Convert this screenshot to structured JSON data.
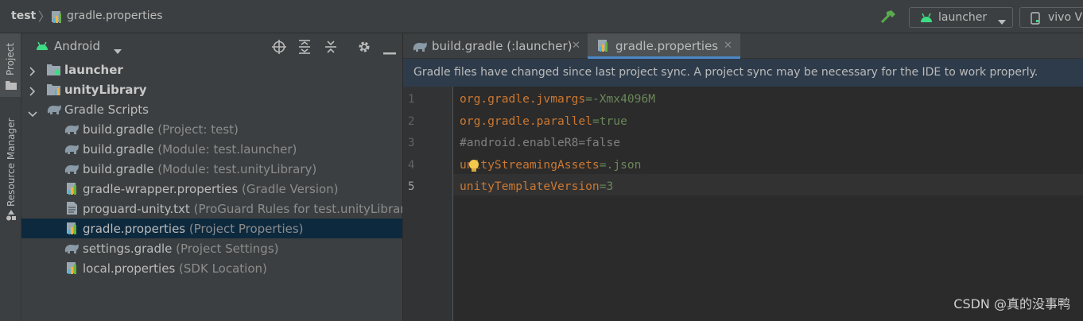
{
  "breadcrumb": {
    "project": "test",
    "file": "gradle.properties"
  },
  "toolbar": {
    "run_config": "launcher",
    "device": "vivo V"
  },
  "side_stripe": {
    "project_label": "Project",
    "resource_manager_label": "Resource Manager"
  },
  "project_panel": {
    "view_mode": "Android",
    "tree": [
      {
        "label": "launcher",
        "hint": ""
      },
      {
        "label": "unityLibrary",
        "hint": ""
      },
      {
        "label": "Gradle Scripts",
        "hint": ""
      },
      {
        "label": "build.gradle",
        "hint": "(Project: test)"
      },
      {
        "label": "build.gradle",
        "hint": "(Module: test.launcher)"
      },
      {
        "label": "build.gradle",
        "hint": "(Module: test.unityLibrary)"
      },
      {
        "label": "gradle-wrapper.properties",
        "hint": "(Gradle Version)"
      },
      {
        "label": "proguard-unity.txt",
        "hint": "(ProGuard Rules for test.unityLibrary)"
      },
      {
        "label": "gradle.properties",
        "hint": "(Project Properties)"
      },
      {
        "label": "settings.gradle",
        "hint": "(Project Settings)"
      },
      {
        "label": "local.properties",
        "hint": "(SDK Location)"
      }
    ]
  },
  "editor": {
    "tabs": [
      {
        "label": "build.gradle (:launcher)"
      },
      {
        "label": "gradle.properties"
      }
    ],
    "banner": "Gradle files have changed since last project sync. A project sync may be necessary for the IDE to work properly.",
    "line_numbers": [
      "1",
      "2",
      "3",
      "4",
      "5"
    ],
    "lines": [
      {
        "key": "org.gradle.jvmargs",
        "sep": "=",
        "value": "-Xmx4096M"
      },
      {
        "key": "org.gradle.parallel",
        "sep": "=",
        "value": "true"
      },
      {
        "comment": "#android.enableR8=false"
      },
      {
        "key": "unityStreamingAssets",
        "sep": "=",
        "value": ".json"
      },
      {
        "key": "unityTemplateVersion",
        "sep": "=",
        "value": "3"
      }
    ]
  },
  "watermark": "CSDN @真的没事鸭",
  "colors": {
    "selection": "#0d293e",
    "key": "#cc7832",
    "value": "#6a8759",
    "banner": "#2e3b4a",
    "android_green": "#3ddc84"
  }
}
